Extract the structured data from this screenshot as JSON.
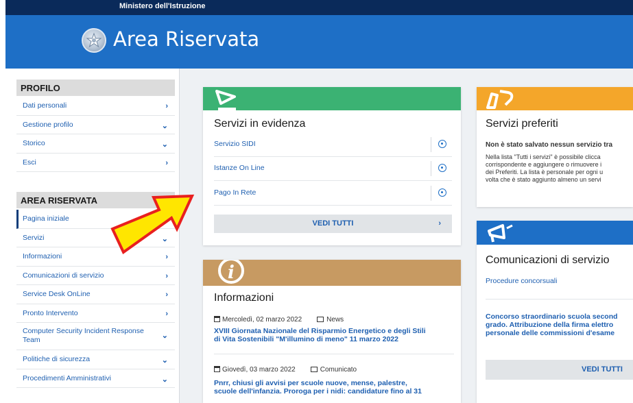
{
  "topbar": {
    "ministry": "Ministero dell'Istruzione"
  },
  "header": {
    "title": "Area Riservata"
  },
  "sidebar": {
    "profilo": {
      "title": "PROFILO",
      "items": [
        {
          "label": "Dati personali",
          "chevron": "›"
        },
        {
          "label": "Gestione profilo",
          "chevron": "⌄"
        },
        {
          "label": "Storico",
          "chevron": "⌄"
        },
        {
          "label": "Esci",
          "chevron": "›"
        }
      ]
    },
    "area": {
      "title": "AREA RISERVATA",
      "items": [
        {
          "label": "Pagina iniziale",
          "chevron": ""
        },
        {
          "label": "Servizi",
          "chevron": "⌄"
        },
        {
          "label": "Informazioni",
          "chevron": "›"
        },
        {
          "label": "Comunicazioni di servizio",
          "chevron": "›"
        },
        {
          "label": "Service Desk OnLine",
          "chevron": "›"
        },
        {
          "label": "Pronto Intervento",
          "chevron": "›"
        },
        {
          "label": "Computer Security Incident Response Team",
          "chevron": "⌄"
        },
        {
          "label": "Politiche di sicurezza",
          "chevron": "⌄"
        },
        {
          "label": "Procedimenti Amministrativi",
          "chevron": "⌄"
        }
      ]
    }
  },
  "servizi_evidenza": {
    "title": "Servizi in evidenza",
    "items": [
      "Servizio SIDI",
      "Istanze On Line",
      "Pago In Rete"
    ],
    "button": "VEDI TUTTI",
    "button_chevron": "›",
    "band_color": "#3bb273"
  },
  "informazioni": {
    "title": "Informazioni",
    "band_color": "#c79a62",
    "entries": [
      {
        "date": "Mercoledì, 02 marzo 2022",
        "category": "News",
        "headline_line1": "XVIII Giornata Nazionale del Risparmio Energetico e degli Stili",
        "headline_line2": "di Vita Sostenibili \"M'illumino di meno\" 11 marzo 2022"
      },
      {
        "date": "Giovedì, 03 marzo 2022",
        "category": "Comunicato",
        "headline_line1": "Pnrr, chiusi gli avvisi per scuole nuove, mense, palestre,",
        "headline_line2": "scuole dell'infanzia. Proroga per i nidi: candidature fino al 31"
      }
    ]
  },
  "servizi_preferiti": {
    "title": "Servizi preferiti",
    "band_color": "#f4a62a",
    "bold_text": "Non è stato salvato nessun servizio tra",
    "text_lines": [
      "Nella lista \"Tutti i servizi\" è possibile clicca",
      "corrispondente e aggiungere o rimuovere i",
      "dei Preferiti. La lista è personale per ogni u",
      "volta che è stato aggiunto almeno un servi"
    ]
  },
  "comunicazioni": {
    "title": "Comunicazioni di servizio",
    "band_color": "#1e6fc6",
    "link1": "Procedure concorsuali",
    "link2_lines": [
      "Concorso straordinario scuola second",
      "grado. Attribuzione della firma elettro",
      "personale delle commissioni d'esame"
    ],
    "button": "VEDI TUTTI"
  }
}
